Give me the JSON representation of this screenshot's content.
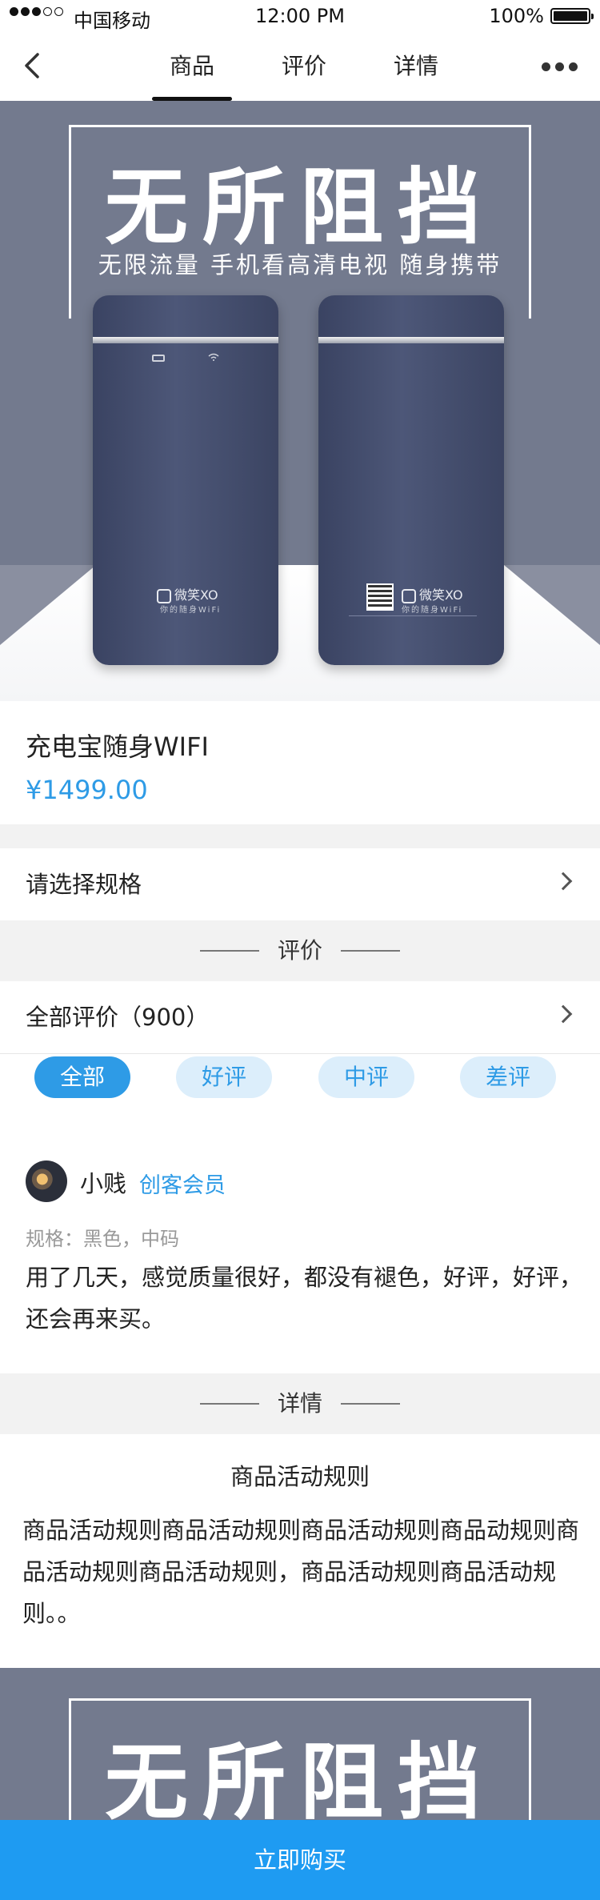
{
  "status_bar": {
    "carrier": "中国移动",
    "time": "12:00 PM",
    "battery": "100%"
  },
  "nav": {
    "tabs": [
      {
        "label": "商品",
        "active": true
      },
      {
        "label": "评价",
        "active": false
      },
      {
        "label": "详情",
        "active": false
      }
    ],
    "back_icon": "chevron-left-icon",
    "more_icon": "more-dots-icon"
  },
  "hero": {
    "title": "无所阻挡",
    "subtitle": "无限流量  手机看高清电视  随身携带",
    "device_brand": "微笑XO",
    "device_slogan": "你的随身WiFi"
  },
  "product": {
    "name": "充电宝随身WIFI",
    "price": "¥1499.00"
  },
  "spec_row": {
    "label": "请选择规格"
  },
  "reviews_section": {
    "header": "评价",
    "all_reviews_label": "全部评价（900）",
    "filters": [
      {
        "label": "全部",
        "active": true
      },
      {
        "label": "好评",
        "active": false
      },
      {
        "label": "中评",
        "active": false
      },
      {
        "label": "差评",
        "active": false
      }
    ],
    "review": {
      "user": "小贱",
      "badge": "创客会员",
      "spec": "规格：黑色，中码",
      "text": "用了几天，感觉质量很好，都没有褪色，好评，好评，还会再来买。"
    }
  },
  "details_section": {
    "header": "详情",
    "title": "商品活动规则",
    "text": "商品活动规则商品活动规则商品活动规则商品动规则商品活动规则商品活动规则，商品活动规则商品活动规则。。"
  },
  "hero2": {
    "title": "无所阻挡"
  },
  "buy_button": {
    "label": "立即购买"
  },
  "colors": {
    "accent": "#2e9be6",
    "buy_bar": "#1e9bf2",
    "hero_bg": "#737a8e",
    "section_bg": "#f2f2f2"
  }
}
